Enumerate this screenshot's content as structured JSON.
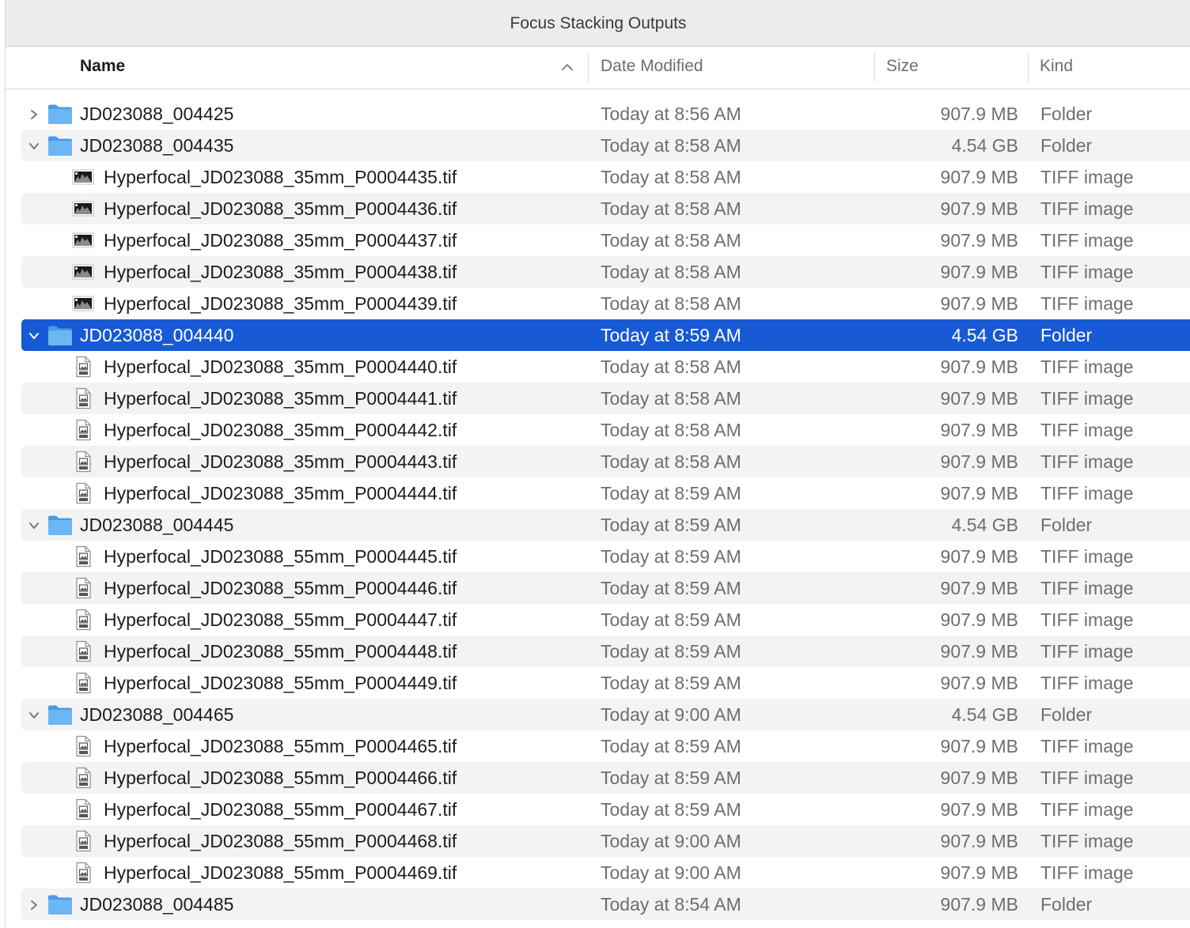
{
  "window": {
    "title": "Focus Stacking Outputs"
  },
  "columns": {
    "name": "Name",
    "date": "Date Modified",
    "size": "Size",
    "kind": "Kind"
  },
  "colors": {
    "selection": "#1859d6",
    "folder": "#5aa9ee",
    "alt_row": "#f3f3f3"
  },
  "rows": [
    {
      "type": "folder",
      "expanded": false,
      "name": "JD023088_004425",
      "date": "Today at 8:56 AM",
      "size": "907.9 MB",
      "kind": "Folder"
    },
    {
      "type": "folder",
      "expanded": true,
      "name": "JD023088_004435",
      "date": "Today at 8:58 AM",
      "size": "4.54 GB",
      "kind": "Folder"
    },
    {
      "type": "file",
      "icon": "image-thumbnail-icon",
      "name": "Hyperfocal_JD023088_35mm_P0004435.tif",
      "date": "Today at 8:58 AM",
      "size": "907.9 MB",
      "kind": "TIFF image"
    },
    {
      "type": "file",
      "icon": "image-thumbnail-icon",
      "name": "Hyperfocal_JD023088_35mm_P0004436.tif",
      "date": "Today at 8:58 AM",
      "size": "907.9 MB",
      "kind": "TIFF image"
    },
    {
      "type": "file",
      "icon": "image-thumbnail-icon",
      "name": "Hyperfocal_JD023088_35mm_P0004437.tif",
      "date": "Today at 8:58 AM",
      "size": "907.9 MB",
      "kind": "TIFF image"
    },
    {
      "type": "file",
      "icon": "image-thumbnail-icon",
      "name": "Hyperfocal_JD023088_35mm_P0004438.tif",
      "date": "Today at 8:58 AM",
      "size": "907.9 MB",
      "kind": "TIFF image"
    },
    {
      "type": "file",
      "icon": "image-thumbnail-icon",
      "name": "Hyperfocal_JD023088_35mm_P0004439.tif",
      "date": "Today at 8:58 AM",
      "size": "907.9 MB",
      "kind": "TIFF image"
    },
    {
      "type": "folder",
      "expanded": true,
      "selected": true,
      "name": "JD023088_004440",
      "date": "Today at 8:59 AM",
      "size": "4.54 GB",
      "kind": "Folder"
    },
    {
      "type": "file",
      "icon": "tiff-document-icon",
      "name": "Hyperfocal_JD023088_35mm_P0004440.tif",
      "date": "Today at 8:58 AM",
      "size": "907.9 MB",
      "kind": "TIFF image"
    },
    {
      "type": "file",
      "icon": "tiff-document-icon",
      "name": "Hyperfocal_JD023088_35mm_P0004441.tif",
      "date": "Today at 8:58 AM",
      "size": "907.9 MB",
      "kind": "TIFF image"
    },
    {
      "type": "file",
      "icon": "tiff-document-icon",
      "name": "Hyperfocal_JD023088_35mm_P0004442.tif",
      "date": "Today at 8:58 AM",
      "size": "907.9 MB",
      "kind": "TIFF image"
    },
    {
      "type": "file",
      "icon": "tiff-document-icon",
      "name": "Hyperfocal_JD023088_35mm_P0004443.tif",
      "date": "Today at 8:58 AM",
      "size": "907.9 MB",
      "kind": "TIFF image"
    },
    {
      "type": "file",
      "icon": "tiff-document-icon",
      "name": "Hyperfocal_JD023088_35mm_P0004444.tif",
      "date": "Today at 8:59 AM",
      "size": "907.9 MB",
      "kind": "TIFF image"
    },
    {
      "type": "folder",
      "expanded": true,
      "name": "JD023088_004445",
      "date": "Today at 8:59 AM",
      "size": "4.54 GB",
      "kind": "Folder"
    },
    {
      "type": "file",
      "icon": "tiff-document-icon",
      "name": "Hyperfocal_JD023088_55mm_P0004445.tif",
      "date": "Today at 8:59 AM",
      "size": "907.9 MB",
      "kind": "TIFF image"
    },
    {
      "type": "file",
      "icon": "tiff-document-icon",
      "name": "Hyperfocal_JD023088_55mm_P0004446.tif",
      "date": "Today at 8:59 AM",
      "size": "907.9 MB",
      "kind": "TIFF image"
    },
    {
      "type": "file",
      "icon": "tiff-document-icon",
      "name": "Hyperfocal_JD023088_55mm_P0004447.tif",
      "date": "Today at 8:59 AM",
      "size": "907.9 MB",
      "kind": "TIFF image"
    },
    {
      "type": "file",
      "icon": "tiff-document-icon",
      "name": "Hyperfocal_JD023088_55mm_P0004448.tif",
      "date": "Today at 8:59 AM",
      "size": "907.9 MB",
      "kind": "TIFF image"
    },
    {
      "type": "file",
      "icon": "tiff-document-icon",
      "name": "Hyperfocal_JD023088_55mm_P0004449.tif",
      "date": "Today at 8:59 AM",
      "size": "907.9 MB",
      "kind": "TIFF image"
    },
    {
      "type": "folder",
      "expanded": true,
      "name": "JD023088_004465",
      "date": "Today at 9:00 AM",
      "size": "4.54 GB",
      "kind": "Folder"
    },
    {
      "type": "file",
      "icon": "tiff-document-icon",
      "name": "Hyperfocal_JD023088_55mm_P0004465.tif",
      "date": "Today at 8:59 AM",
      "size": "907.9 MB",
      "kind": "TIFF image"
    },
    {
      "type": "file",
      "icon": "tiff-document-icon",
      "name": "Hyperfocal_JD023088_55mm_P0004466.tif",
      "date": "Today at 8:59 AM",
      "size": "907.9 MB",
      "kind": "TIFF image"
    },
    {
      "type": "file",
      "icon": "tiff-document-icon",
      "name": "Hyperfocal_JD023088_55mm_P0004467.tif",
      "date": "Today at 8:59 AM",
      "size": "907.9 MB",
      "kind": "TIFF image"
    },
    {
      "type": "file",
      "icon": "tiff-document-icon",
      "name": "Hyperfocal_JD023088_55mm_P0004468.tif",
      "date": "Today at 9:00 AM",
      "size": "907.9 MB",
      "kind": "TIFF image"
    },
    {
      "type": "file",
      "icon": "tiff-document-icon",
      "name": "Hyperfocal_JD023088_55mm_P0004469.tif",
      "date": "Today at 9:00 AM",
      "size": "907.9 MB",
      "kind": "TIFF image"
    },
    {
      "type": "folder",
      "expanded": false,
      "name": "JD023088_004485",
      "date": "Today at 8:54 AM",
      "size": "907.9 MB",
      "kind": "Folder"
    }
  ]
}
